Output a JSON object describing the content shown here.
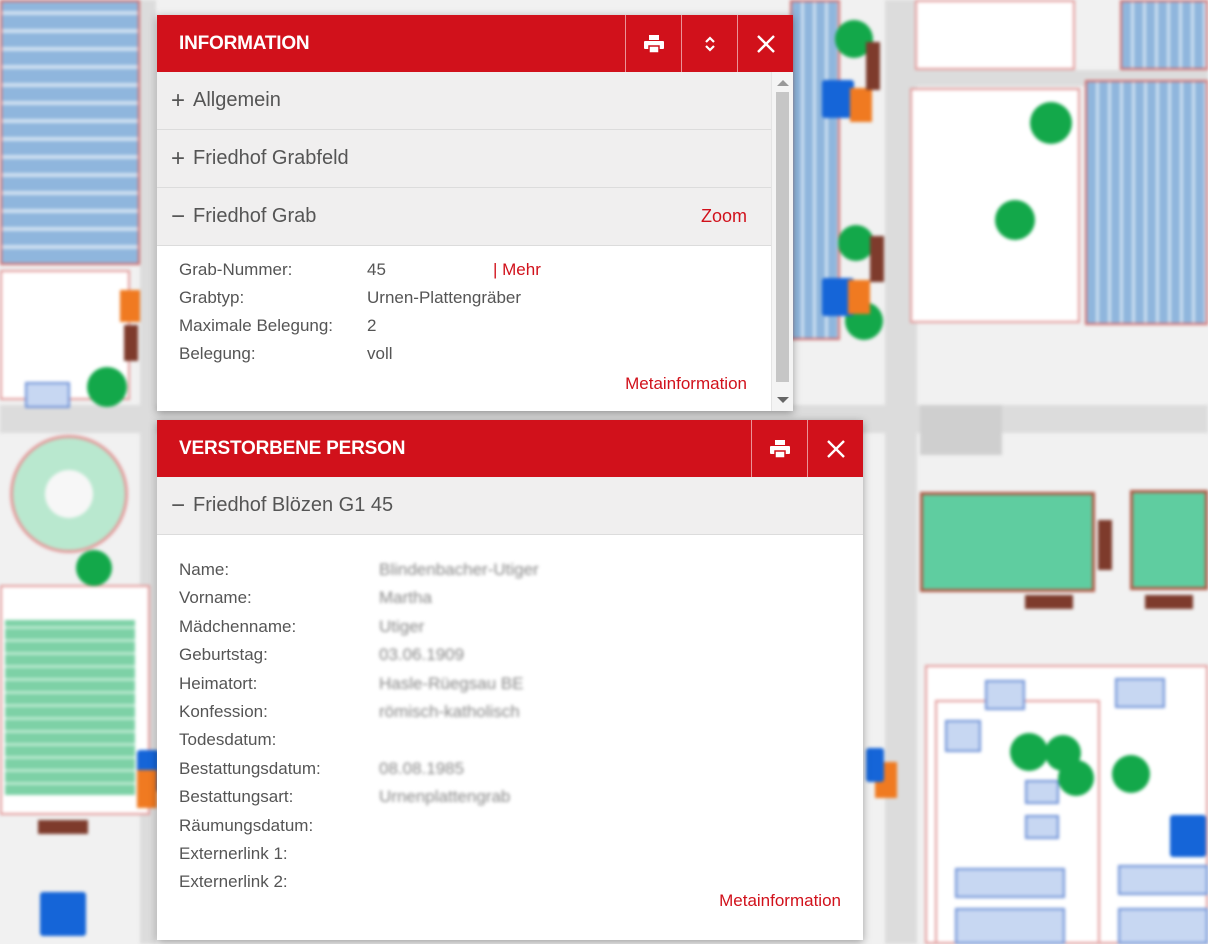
{
  "info_panel": {
    "title": "INFORMATION",
    "sections": [
      {
        "sign": "+",
        "label": "Allgemein"
      },
      {
        "sign": "+",
        "label": "Friedhof Grabfeld"
      },
      {
        "sign": "−",
        "label": "Friedhof Grab",
        "action": "Zoom"
      }
    ],
    "fields": [
      {
        "label": "Grab-Nummer:",
        "value": "45",
        "link": "| Mehr"
      },
      {
        "label": "Grabtyp:",
        "value": "Urnen-Plattengräber"
      },
      {
        "label": "Maximale Belegung:",
        "value": "2"
      },
      {
        "label": "Belegung:",
        "value": "voll"
      }
    ],
    "metainfo": "Metainformation"
  },
  "person_panel": {
    "title": "VERSTORBENE PERSON",
    "section": {
      "sign": "−",
      "label": "Friedhof Blözen G1 45"
    },
    "fields": [
      {
        "label": "Name:",
        "value": "Blindenbacher-Utiger"
      },
      {
        "label": "Vorname:",
        "value": "Martha"
      },
      {
        "label": "Mädchenname:",
        "value": "Utiger"
      },
      {
        "label": "Geburtstag:",
        "value": "03.06.1909"
      },
      {
        "label": "Heimatort:",
        "value": "Hasle-Rüegsau BE"
      },
      {
        "label": "Konfession:",
        "value": "römisch-katholisch"
      },
      {
        "label": "Todesdatum:",
        "value": ""
      },
      {
        "label": "Bestattungsdatum:",
        "value": "08.08.1985"
      },
      {
        "label": "Bestattungsart:",
        "value": "Urnenplattengrab"
      },
      {
        "label": "Räumungsdatum:",
        "value": ""
      },
      {
        "label": "Externerlink 1:",
        "value": ""
      },
      {
        "label": "Externerlink 2:",
        "value": ""
      }
    ],
    "metainfo": "Metainformation"
  },
  "icons": {
    "print": "print-icon",
    "collapse": "expand-collapse-icon",
    "close": "close-icon"
  },
  "colors": {
    "header_red": "#d1111b",
    "link_red": "#d1111b",
    "section_bg": "#f0efef"
  }
}
